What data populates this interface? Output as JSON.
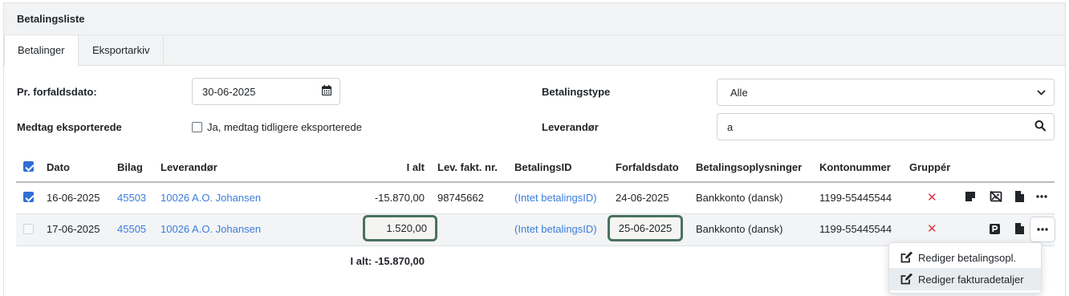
{
  "panel": {
    "title": "Betalingsliste"
  },
  "tabs": [
    {
      "label": "Betalinger",
      "active": true
    },
    {
      "label": "Eksportarkiv",
      "active": false
    }
  ],
  "filters": {
    "due_date_label": "Pr. forfaldsdato:",
    "due_date_value": "30-06-2025",
    "include_exported_label": "Medtag eksporterede",
    "include_exported_checkbox_label": "Ja, medtag tidligere eksporterede",
    "include_exported_checked": false,
    "payment_type_label": "Betalingstype",
    "payment_type_value": "Alle",
    "supplier_label": "Leverandør",
    "supplier_value": "a"
  },
  "table": {
    "headers": {
      "date": "Dato",
      "voucher": "Bilag",
      "supplier": "Leverandør",
      "total": "I alt",
      "invoice_no": "Lev. fakt. nr.",
      "payment_id": "BetalingsID",
      "due_date": "Forfaldsdato",
      "payment_info": "Betalingsoplysninger",
      "account_no": "Kontonummer",
      "group": "Gruppér"
    },
    "header_checked": true,
    "rows": [
      {
        "checked": true,
        "date": "16-06-2025",
        "voucher": "45503",
        "supplier": "10026 A.O. Johansen",
        "total": "-15.870,00",
        "invoice_no": "98745662",
        "payment_id": "(Intet betalingsID)",
        "due_date": "24-06-2025",
        "payment_info": "Bankkonto (dansk)",
        "account_no": "1199-55445544",
        "group": "✕"
      },
      {
        "checked": false,
        "date": "17-06-2025",
        "voucher": "45505",
        "supplier": "10026 A.O. Johansen",
        "total": "1.520,00",
        "invoice_no": "",
        "payment_id": "(Intet betalingsID)",
        "due_date": "25-06-2025",
        "payment_info": "Bankkonto (dansk)",
        "account_no": "1199-55445544",
        "group": "✕"
      }
    ],
    "footer_total": "I alt: -15.870,00"
  },
  "dropdown_menu": {
    "items": [
      {
        "label": "Rediger betalingsopl."
      },
      {
        "label": "Rediger fakturadetaljer"
      }
    ]
  },
  "colors": {
    "link": "#3b7ddd",
    "accent": "#2f6fd6",
    "danger": "#dc3545",
    "highlight_border": "#4a7160"
  }
}
